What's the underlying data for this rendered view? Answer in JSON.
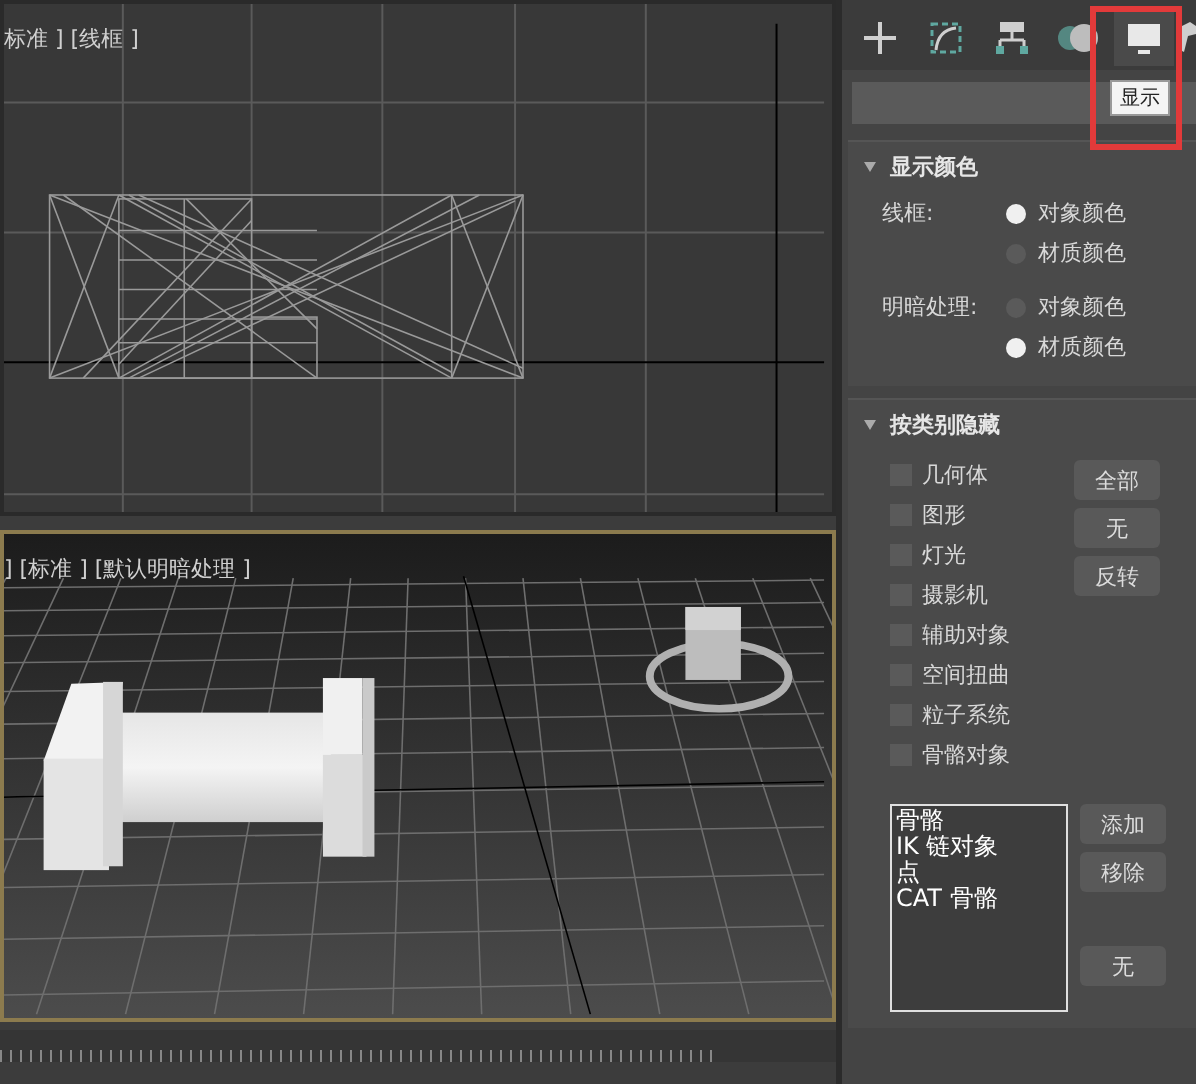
{
  "viewports": [
    {
      "label": "标准 ] [线框 ]",
      "active": false,
      "kind": "wireframe"
    },
    {
      "label": "] [标准 ] [默认明暗处理 ]",
      "active": true,
      "kind": "shaded"
    }
  ],
  "command_tabs": [
    {
      "kind": "create",
      "selected": false,
      "highlighted": false
    },
    {
      "kind": "modify",
      "selected": false,
      "highlighted": false
    },
    {
      "kind": "hierarchy",
      "selected": false,
      "highlighted": false
    },
    {
      "kind": "motion",
      "selected": false,
      "highlighted": false
    },
    {
      "kind": "display",
      "selected": true,
      "highlighted": true
    },
    {
      "kind": "utilities",
      "selected": false,
      "highlighted": false
    }
  ],
  "tooltip": "显示",
  "display_color": {
    "title": "显示颜色",
    "expanded": true,
    "groups": [
      {
        "label": "线框:",
        "options": [
          {
            "label": "对象颜色",
            "selected": true
          },
          {
            "label": "材质颜色",
            "selected": false
          }
        ]
      },
      {
        "label": "明暗处理:",
        "options": [
          {
            "label": "对象颜色",
            "selected": false
          },
          {
            "label": "材质颜色",
            "selected": true
          }
        ]
      }
    ]
  },
  "hide_by_category": {
    "title": "按类别隐藏",
    "expanded": true,
    "categories": [
      {
        "label": "几何体",
        "checked": false
      },
      {
        "label": "图形",
        "checked": false
      },
      {
        "label": "灯光",
        "checked": false
      },
      {
        "label": "摄影机",
        "checked": false
      },
      {
        "label": "辅助对象",
        "checked": false
      },
      {
        "label": "空间扭曲",
        "checked": false
      },
      {
        "label": "粒子系统",
        "checked": false
      },
      {
        "label": "骨骼对象",
        "checked": false
      }
    ],
    "buttons": [
      "全部",
      "无",
      "反转"
    ],
    "list_items": [
      "骨骼",
      "IK 链对象",
      "点",
      "CAT 骨骼"
    ],
    "list_buttons": [
      "添加",
      "移除",
      "无"
    ]
  }
}
